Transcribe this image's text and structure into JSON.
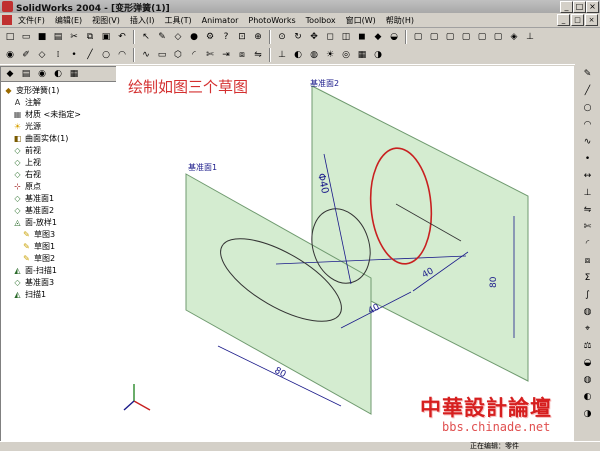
{
  "window": {
    "title": "SolidWorks 2004 - [变形弹簧(1)]",
    "buttons": {
      "minimize": "_",
      "maximize": "□",
      "close": "×"
    }
  },
  "menu": {
    "items": [
      "文件(F)",
      "编辑(E)",
      "视图(V)",
      "插入(I)",
      "工具(T)",
      "Animator",
      "PhotoWorks",
      "Toolbox",
      "窗口(W)",
      "帮助(H)"
    ]
  },
  "toolbar_rows": [
    [
      "new-icon",
      "open-icon",
      "save-icon",
      "print-icon",
      "cut-icon",
      "copy-icon",
      "paste-icon",
      "undo-icon",
      "select-icon",
      "sketch-icon",
      "smart-dimension-icon",
      "rebuild-icon",
      "options-icon",
      "help-icon",
      "zoom-fit-icon",
      "zoom-area-icon",
      "zoom-in-icon",
      "rotate-icon",
      "pan-icon",
      "wireframe-icon",
      "hidden-lines-icon",
      "shaded-icon",
      "perspective-icon",
      "section-icon",
      "front-view-icon",
      "back-view-icon",
      "left-view-icon",
      "right-view-icon",
      "top-view-icon",
      "bottom-view-icon",
      "iso-view-icon",
      "normal-to-icon"
    ],
    [
      "feature-icon",
      "sketch-tool-icon",
      "plane-icon",
      "axis-icon",
      "point-icon",
      "line-icon",
      "circle-icon",
      "arc-icon",
      "spline-icon",
      "rectangle-icon",
      "polygon-icon",
      "fillet-icon",
      "trim-icon",
      "extend-icon",
      "offset-icon",
      "mirror-icon",
      "relation-icon",
      "display-icon",
      "color-icon",
      "light-icon",
      "camera-icon",
      "material-icon",
      "render-icon"
    ]
  ],
  "tree": {
    "tabs": [
      "feature-manager-icon",
      "property-manager-icon",
      "configuration-manager-icon",
      "photoworks-icon",
      "toolbox-icon"
    ],
    "items": [
      {
        "label": "变形弹簧(1)",
        "icon": "part-icon",
        "indent": 0
      },
      {
        "label": "注解",
        "icon": "annotation-icon",
        "indent": 1
      },
      {
        "label": "材质 <未指定>",
        "icon": "material-icon",
        "indent": 1
      },
      {
        "label": "光源",
        "icon": "light-icon",
        "indent": 1
      },
      {
        "label": "曲面实体(1)",
        "icon": "surface-body-icon",
        "indent": 1
      },
      {
        "label": "前视",
        "icon": "plane-icon",
        "indent": 1
      },
      {
        "label": "上视",
        "icon": "plane-icon",
        "indent": 1
      },
      {
        "label": "右视",
        "icon": "plane-icon",
        "indent": 1
      },
      {
        "label": "原点",
        "icon": "origin-icon",
        "indent": 1
      },
      {
        "label": "基准面1",
        "icon": "plane-icon",
        "indent": 1
      },
      {
        "label": "基准面2",
        "icon": "plane-icon",
        "indent": 1
      },
      {
        "label": "面-放样1",
        "icon": "loft-icon",
        "indent": 1
      },
      {
        "label": "草图3",
        "icon": "sketch-icon",
        "indent": 2
      },
      {
        "label": "草图1",
        "icon": "sketch-icon",
        "indent": 2
      },
      {
        "label": "草图2",
        "icon": "sketch-icon",
        "indent": 2
      },
      {
        "label": "面-扫描1",
        "icon": "sweep-icon",
        "indent": 1
      },
      {
        "label": "基准面3",
        "icon": "plane-icon",
        "indent": 1
      },
      {
        "label": "扫描1",
        "icon": "sweep-icon",
        "indent": 1
      }
    ]
  },
  "canvas": {
    "caption": "绘制如图三个草图",
    "plane_labels": [
      "基准面1",
      "基准面2"
    ],
    "dimensions": {
      "diameter": "Φ40",
      "d1": "40",
      "d2": "40",
      "width": "80",
      "height": "80"
    },
    "colors": {
      "plane_fill": "#d4ecd0",
      "plane_stroke": "#6f9a6f",
      "sketch_red": "#c82020",
      "caption": "#d43030",
      "dim_blue": "#1a1a8a"
    }
  },
  "right_toolbar": [
    "sketch-icon",
    "line-icon",
    "circle-icon",
    "arc-icon",
    "spline-icon",
    "point-icon",
    "dimension-icon",
    "relation-icon",
    "mirror-icon",
    "trim-icon",
    "fillet-icon",
    "offset-icon",
    "sigma-icon",
    "spline-tool-icon",
    "color-icon",
    "measure-icon",
    "mass-icon",
    "section-icon",
    "appearance-icon",
    "display-icon",
    "render-icon"
  ],
  "status": {
    "text": "正在编辑：零件"
  },
  "watermark": {
    "title": "中華設計論壇",
    "url": "bbs.chinade.net"
  }
}
